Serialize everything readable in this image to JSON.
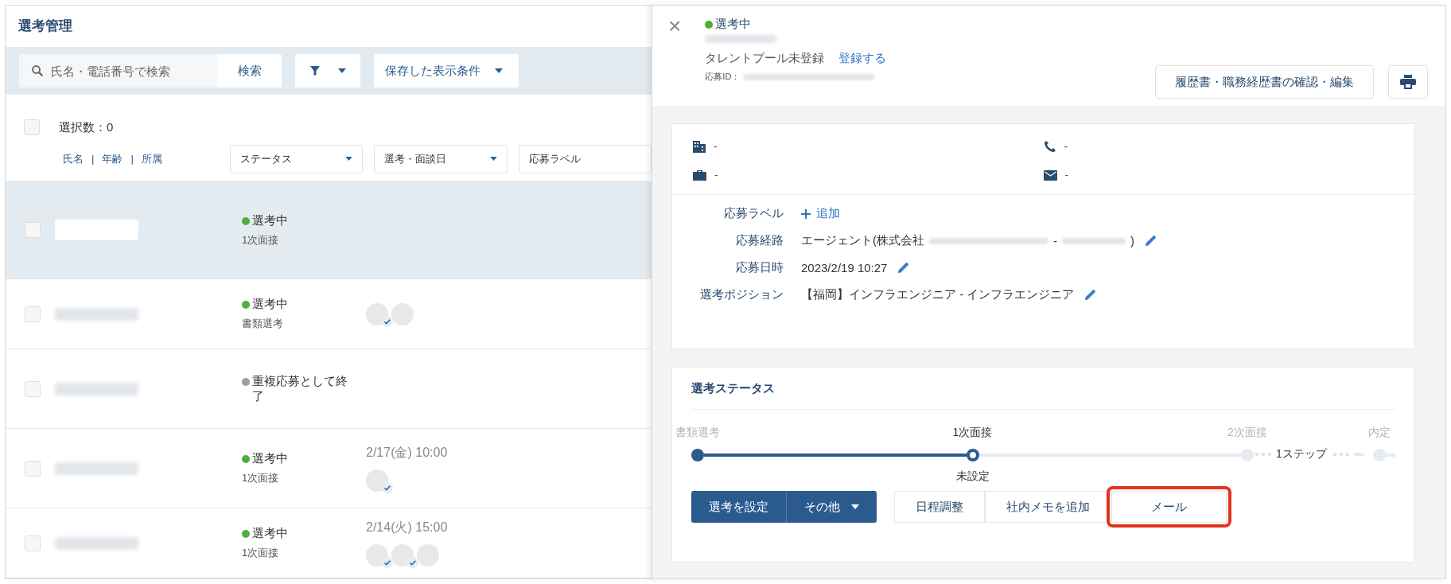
{
  "list": {
    "title": "選考管理",
    "search": {
      "placeholder": "氏名・電話番号で検索",
      "button": "検索"
    },
    "saved_views": "保存した表示条件",
    "select_all": {
      "checked": false
    },
    "selection_count": "選択数：0",
    "sort_links": [
      "氏名",
      "年齢",
      "所属"
    ],
    "sort_separator": "|",
    "column_filters": [
      "ステータス",
      "選考・面談日",
      "応募ラベル"
    ],
    "rows": [
      {
        "selected": true,
        "status": "選考中",
        "color": "#4caf3a",
        "stage": "1次面接",
        "avatars": []
      },
      {
        "selected": false,
        "status": "選考中",
        "color": "#4caf3a",
        "stage": "書類選考",
        "avatars": [
          {
            "checked": true
          },
          {
            "checked": false
          }
        ]
      },
      {
        "selected": false,
        "status": "重複応募として終了",
        "color": "#9e9e9e",
        "avatars": []
      },
      {
        "selected": false,
        "status": "選考中",
        "color": "#4caf3a",
        "stage": "1次面接",
        "date": "2/17(金) 10:00",
        "avatars": [
          {
            "checked": true
          }
        ]
      },
      {
        "selected": false,
        "status": "選考中",
        "color": "#4caf3a",
        "stage": "1次面接",
        "date": "2/14(火) 15:00",
        "avatars": [
          {
            "checked": true
          },
          {
            "checked": true
          },
          {
            "checked": false
          }
        ]
      }
    ]
  },
  "detail": {
    "close": "×",
    "status": "選考中",
    "color": "#4caf3a",
    "talent_pool": "タレントプール未登録",
    "register_link": "登録する",
    "application_id_label": "応募ID：",
    "resume_button": "履歴書・職務経歴書の確認・編集",
    "contacts": [
      {
        "kind": "company",
        "value": "-"
      },
      {
        "kind": "phone",
        "value": "-"
      },
      {
        "kind": "job",
        "value": "-"
      },
      {
        "kind": "mail",
        "value": "-"
      }
    ],
    "fields": [
      {
        "label": "応募ラベル",
        "kind": "add",
        "value": "追加",
        "editable": false
      },
      {
        "label": "応募経路",
        "kind": "route",
        "parts": [
          "エージェント(株式会社",
          "-",
          ")"
        ],
        "editable": true
      },
      {
        "label": "応募日時",
        "kind": "text",
        "value": "2023/2/19 10:27",
        "editable": true
      },
      {
        "label": "選考ポジション",
        "kind": "text",
        "value": "【福岡】インフラエンジニア - インフラエンジニア",
        "editable": true
      }
    ],
    "status_section": {
      "title": "選考ステータス",
      "steps": [
        {
          "label": "書類選考",
          "completed": true,
          "selected": false
        },
        {
          "label": "1次面接",
          "completed": false,
          "selected": true,
          "note": "未設定"
        },
        {
          "label": "2次面接",
          "completed": false,
          "selected": false
        },
        {
          "label": "内定",
          "completed": false,
          "selected": false,
          "skipped_before": "1ステップ"
        }
      ],
      "primary_buttons": [
        "選考を設定",
        "その他"
      ],
      "actions": [
        {
          "label": "日程調整",
          "highlighted": false
        },
        {
          "label": "社内メモを追加",
          "highlighted": false
        },
        {
          "label": "メール",
          "highlighted": true
        }
      ]
    }
  }
}
